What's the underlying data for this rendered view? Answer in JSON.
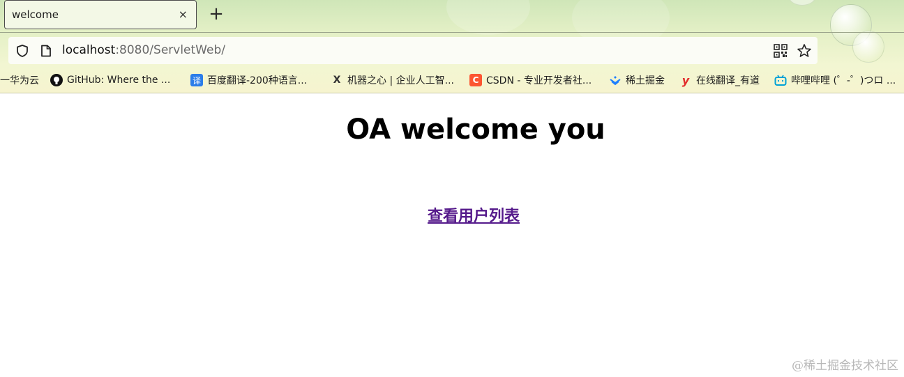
{
  "browser": {
    "tab": {
      "title": "welcome",
      "close_symbol": "×"
    },
    "new_tab_symbol": "+",
    "address": {
      "host": "localhost",
      "rest": ":8080/ServletWeb/"
    },
    "bookmarks": [
      {
        "label": "一华为云",
        "icon": "huawei-cloud-icon"
      },
      {
        "label": "GitHub: Where the ...",
        "icon": "github-icon"
      },
      {
        "label": "百度翻译-200种语言...",
        "icon": "baidu-translate-icon"
      },
      {
        "label": "机器之心 | 企业人工智...",
        "icon": "jiqizhixin-icon"
      },
      {
        "label": "CSDN - 专业开发者社...",
        "icon": "csdn-icon"
      },
      {
        "label": "稀土掘金",
        "icon": "juejin-icon"
      },
      {
        "label": "在线翻译_有道",
        "icon": "youdao-icon"
      },
      {
        "label": "哔哩哔哩 (゜-゜)つロ ...",
        "icon": "bilibili-icon"
      }
    ]
  },
  "page": {
    "heading": "OA welcome you",
    "link": "查看用户列表"
  },
  "watermark": "@稀土掘金技术社区"
}
